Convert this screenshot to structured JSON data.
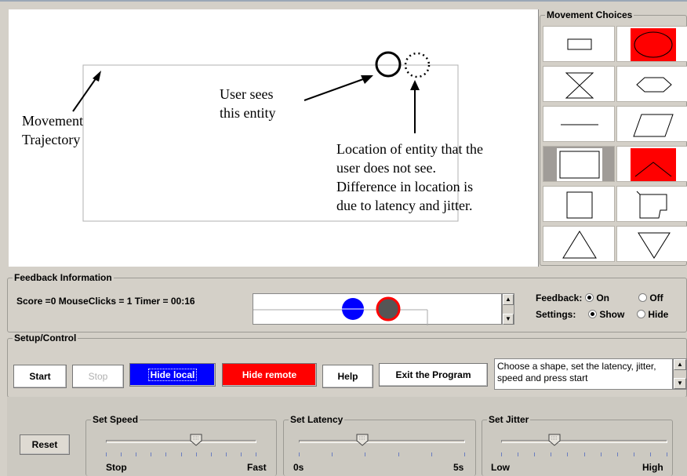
{
  "canvas": {
    "annotations": {
      "trajectory": [
        "Movement",
        "Trajectory"
      ],
      "user_sees": [
        "User sees",
        "this entity"
      ],
      "hidden": [
        "Location of entity that the",
        "user does not see.",
        "Difference in location is",
        "due to latency and jitter."
      ]
    }
  },
  "movement_choices": {
    "title": "Movement Choices",
    "items": [
      {
        "icon": "rectangle-icon",
        "style": "white"
      },
      {
        "icon": "ellipse-icon",
        "style": "red"
      },
      {
        "icon": "hourglass-icon",
        "style": "white"
      },
      {
        "icon": "hexagon-icon",
        "style": "white"
      },
      {
        "icon": "horizontal-line-icon",
        "style": "white"
      },
      {
        "icon": "parallelogram-icon",
        "style": "white"
      },
      {
        "icon": "rectangle-path-icon",
        "style": "selected"
      },
      {
        "icon": "bell-curve-icon",
        "style": "red"
      },
      {
        "icon": "square-icon",
        "style": "white"
      },
      {
        "icon": "irregular-path-icon",
        "style": "white"
      },
      {
        "icon": "triangle-up-icon",
        "style": "white"
      },
      {
        "icon": "triangle-down-icon",
        "style": "white"
      }
    ]
  },
  "feedback": {
    "title": "Feedback Information",
    "status": "Score =0  MouseClicks  = 1  Timer =  00:16",
    "feedback_label": "Feedback:",
    "on": "On",
    "off": "Off",
    "settings_label": "Settings:",
    "show": "Show",
    "hide": "Hide",
    "feedback_selected": "On",
    "settings_selected": "Show",
    "local_color": "#0000ff",
    "remote_color": "#ff0000"
  },
  "setup": {
    "title": "Setup/Control",
    "start": "Start",
    "stop": "Stop",
    "hide_local": "Hide local",
    "hide_remote": "Hide remote",
    "help": "Help",
    "exit": "Exit the Program",
    "message": "Choose a shape, set the latency, jitter, speed and press start",
    "reset": "Reset"
  },
  "sliders": {
    "speed": {
      "title": "Set Speed",
      "min_label": "Stop",
      "max_label": "Fast",
      "value": 0.6
    },
    "latency": {
      "title": "Set Latency",
      "min_label": "0s",
      "max_label": "5s",
      "value": 0.38
    },
    "jitter": {
      "title": "Set Jitter",
      "min_label": "Low",
      "max_label": "High",
      "value": 0.32
    }
  }
}
